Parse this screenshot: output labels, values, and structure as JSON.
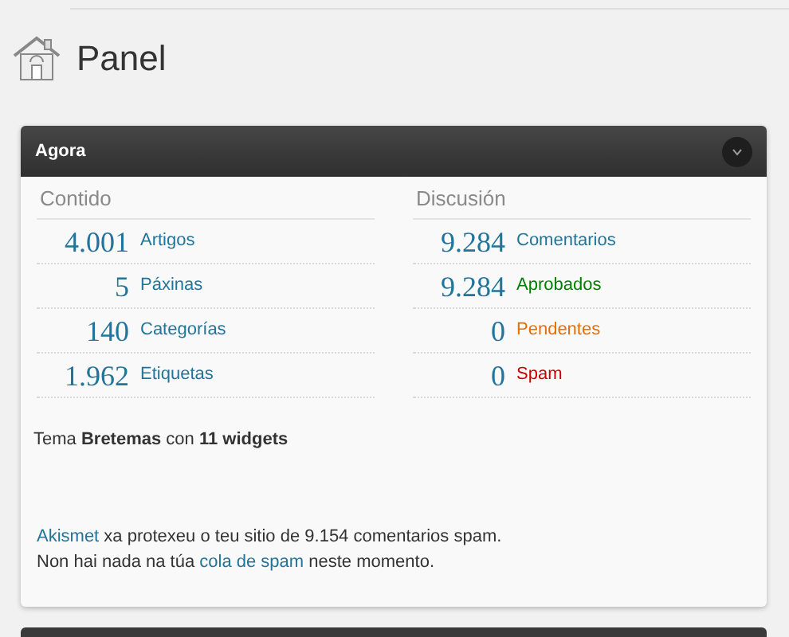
{
  "page_title": "Panel",
  "widget": {
    "title": "Agora",
    "expanded": true,
    "content": {
      "heading": "Contido",
      "rows": [
        {
          "count": "4.001",
          "label": "Artigos",
          "color": "#21759b"
        },
        {
          "count": "5",
          "label": "Páxinas",
          "color": "#21759b"
        },
        {
          "count": "140",
          "label": "Categorías",
          "color": "#21759b"
        },
        {
          "count": "1.962",
          "label": "Etiquetas",
          "color": "#21759b"
        }
      ]
    },
    "discussion": {
      "heading": "Discusión",
      "rows": [
        {
          "count": "9.284",
          "label": "Comentarios",
          "color": "#21759b"
        },
        {
          "count": "9.284",
          "label": "Aprobados",
          "color": "#008000"
        },
        {
          "count": "0",
          "label": "Pendentes",
          "color": "#e66f00"
        },
        {
          "count": "0",
          "label": "Spam",
          "color": "#cc0000"
        }
      ]
    },
    "theme_line": "Tema **Bretemas** con **11 widgets**",
    "akismet_lines": [
      [
        {
          "kind": "link",
          "text": "Akismet"
        },
        {
          "kind": "text",
          "text": " xa protexeu o teu sitio de 9.154 comentarios spam."
        }
      ],
      [
        {
          "kind": "text",
          "text": "Non hai nada na túa "
        },
        {
          "kind": "link",
          "text": "cola de spam"
        },
        {
          "kind": "text",
          "text": " neste momento."
        }
      ]
    ]
  }
}
